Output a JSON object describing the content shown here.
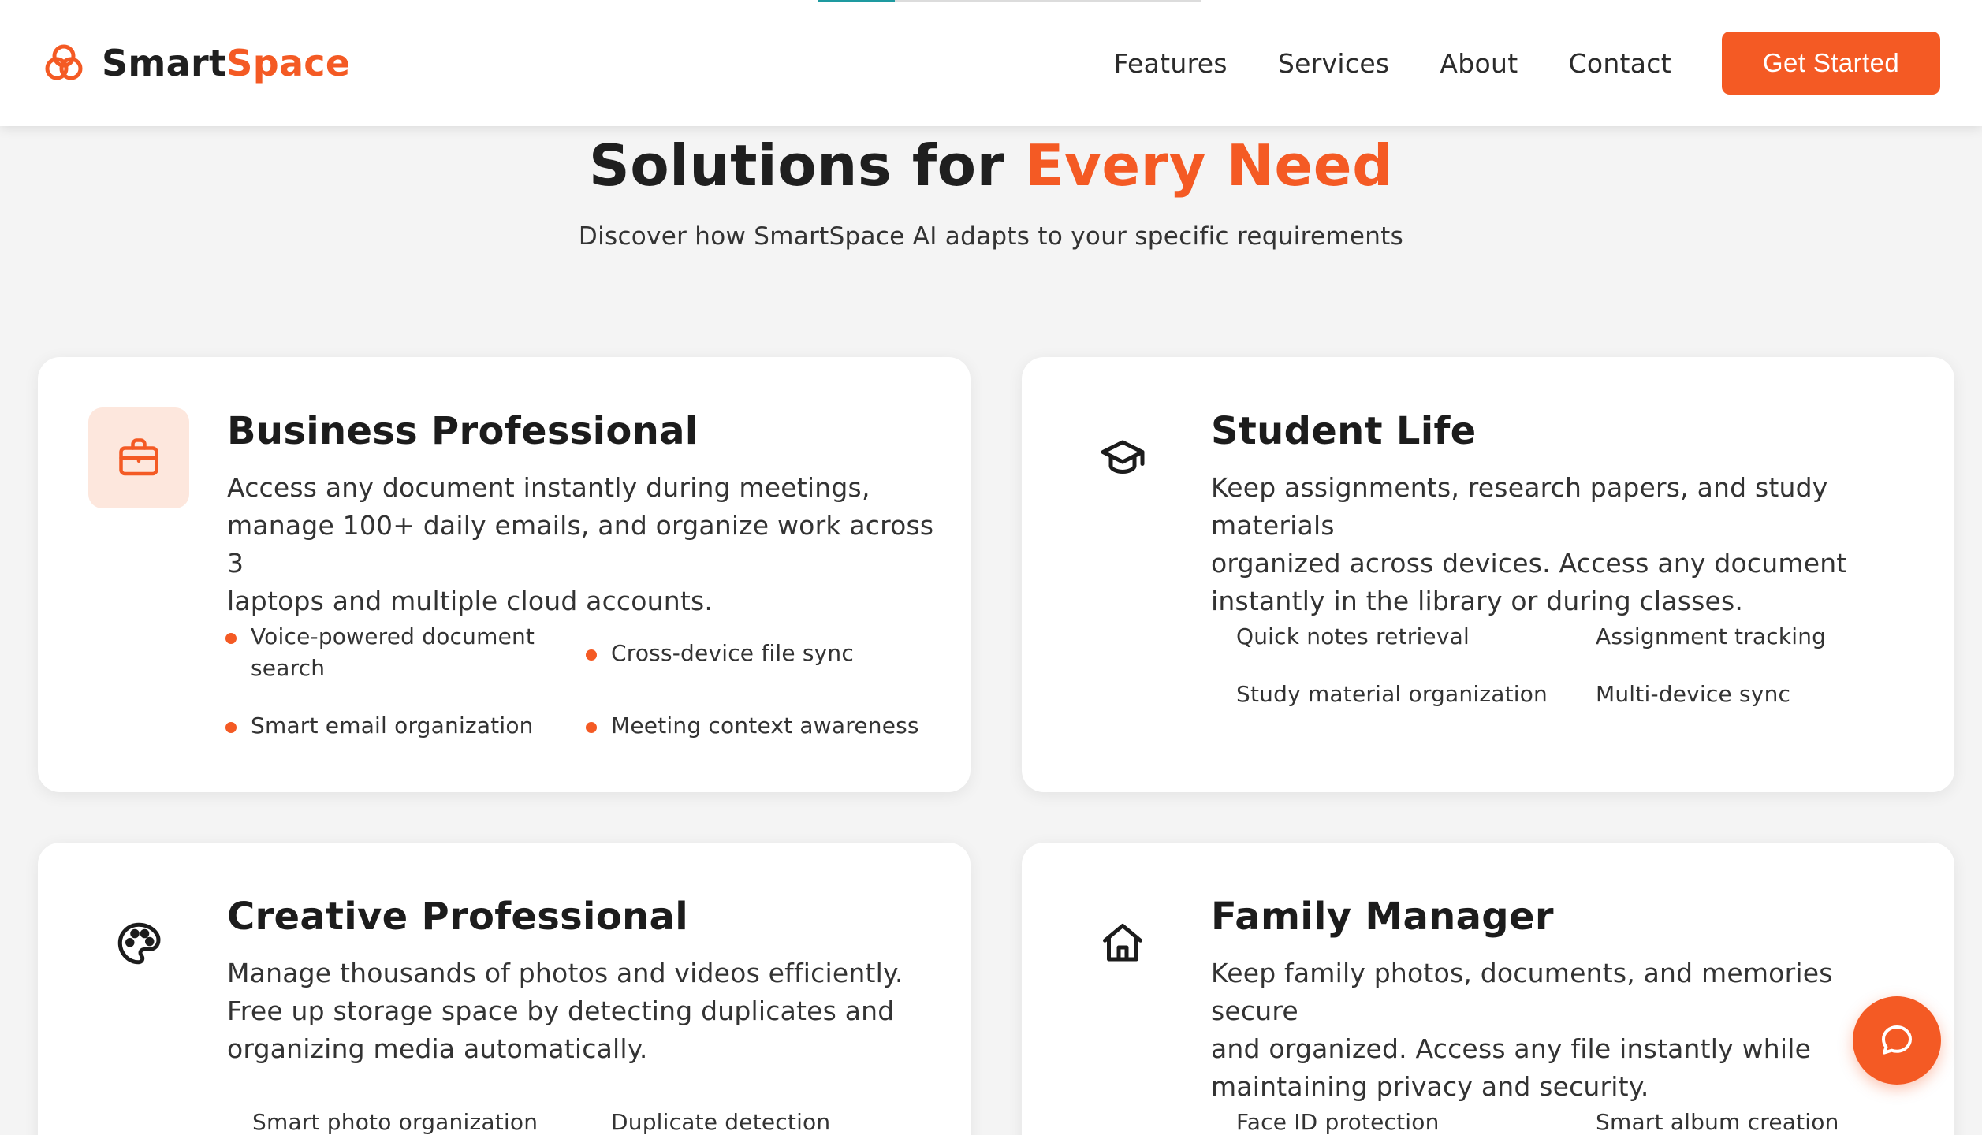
{
  "scroll_progress_percent": 20,
  "brand": {
    "name_part1": "Smart",
    "name_part2": "Space",
    "icon": "interlocking-rings-logo-icon"
  },
  "nav": {
    "links": [
      "Features",
      "Services",
      "About",
      "Contact"
    ],
    "cta_label": "Get Started"
  },
  "hero": {
    "title_part1": "Solutions for ",
    "title_accent": "Every Need",
    "subtitle": "Discover how SmartSpace AI adapts to your specific requirements"
  },
  "colors": {
    "accent": "#f45a24",
    "accent_soft": "#fde7dd",
    "progress": "#1e9aa0"
  },
  "cards": [
    {
      "title": "Business Professional",
      "icon": "briefcase-icon",
      "active": true,
      "desc_lines": [
        "Access any document instantly during meetings,",
        "manage 100+ daily emails, and organize work across 3",
        "laptops and multiple cloud accounts."
      ],
      "features": [
        "Voice-powered document",
        "search",
        "Cross-device file sync",
        "Smart email organization",
        "Meeting context awareness"
      ]
    },
    {
      "title": "Student Life",
      "icon": "graduation-cap-icon",
      "active": false,
      "desc_lines": [
        "Keep assignments, research papers, and study materials",
        "organized across devices. Access any document",
        "instantly in the library or during classes."
      ],
      "features": [
        "Quick notes retrieval",
        "Assignment tracking",
        "Study material organization",
        "Multi-device sync"
      ]
    },
    {
      "title": "Creative Professional",
      "icon": "palette-icon",
      "active": false,
      "desc_lines": [
        "Manage thousands of photos and videos efficiently.",
        "Free up storage space by detecting duplicates and",
        "organizing media automatically."
      ],
      "features": [
        "Smart photo organization",
        "Duplicate detection"
      ]
    },
    {
      "title": "Family Manager",
      "icon": "home-icon",
      "active": false,
      "desc_lines": [
        "Keep family photos, documents, and memories secure",
        "and organized. Access any file instantly while",
        "maintaining privacy and security."
      ],
      "features": [
        "Face ID protection",
        "Smart album creation"
      ]
    }
  ],
  "chat": {
    "icon": "chat-bubble-icon"
  }
}
